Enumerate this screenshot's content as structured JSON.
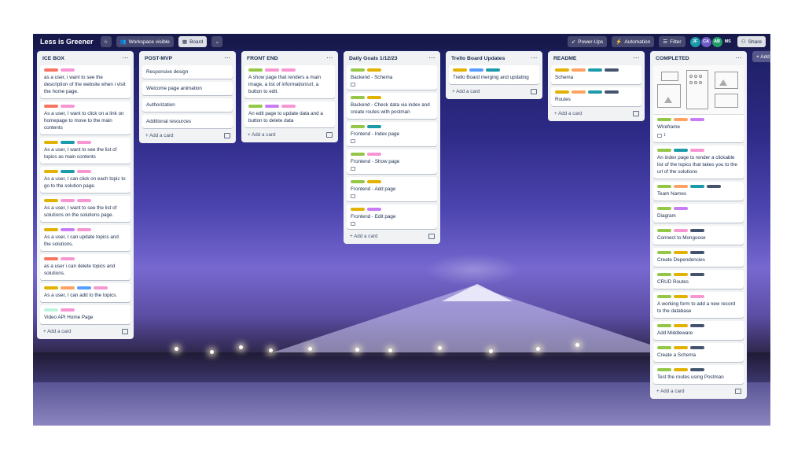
{
  "board": {
    "title": "Less is Greener",
    "visibility_label": "Workspace visible",
    "view_label": "Board",
    "powerups_label": "Power-Ups",
    "automation_label": "Automation",
    "filter_label": "Filter",
    "share_label": "Share",
    "avatars": [
      "JF",
      "CA",
      "AB",
      "MS"
    ],
    "add_list_label": "+ Add another list"
  },
  "labels_colors": {
    "red": "#f87462",
    "pink": "#f797d2",
    "green": "#4bce97",
    "yellow": "#e2b203",
    "teal": "#1d9aaa",
    "purple": "#c97cf4",
    "orange": "#fea362",
    "blue": "#579dff",
    "navy": "#44546f",
    "lightgreen": "#94c748",
    "mint": "#baf3db"
  },
  "add_card_label": "Add a card",
  "lists": [
    {
      "title": "ICE BOX",
      "cards": [
        {
          "labels": [
            "red",
            "pink"
          ],
          "text": "as a user, i want to see the description of the website when i visit the home page."
        },
        {
          "labels": [
            "red",
            "pink"
          ],
          "text": "As a user, I want to click on a link on homepage to move to the main contents"
        },
        {
          "labels": [
            "yellow",
            "teal",
            "pink"
          ],
          "text": "As a user, I want to see the list of topics as main contents"
        },
        {
          "labels": [
            "yellow",
            "teal",
            "pink"
          ],
          "text": "As a user, I can click on each topic to go to the solution page."
        },
        {
          "labels": [
            "yellow",
            "pink",
            "pink"
          ],
          "text": "As a user, I want to see the list of solutions on the solutions page."
        },
        {
          "labels": [
            "yellow",
            "purple",
            "pink"
          ],
          "text": "As a user, I can update topics and the solutions."
        },
        {
          "labels": [
            "red",
            "pink"
          ],
          "text": "as a user i can delete topics and solutions."
        },
        {
          "labels": [
            "yellow",
            "orange",
            "blue",
            "pink"
          ],
          "text": "As a user, I can add to the topics."
        },
        {
          "labels": [
            "mint",
            "pink"
          ],
          "text": "Video API Home Page"
        }
      ]
    },
    {
      "title": "POST-MVP",
      "cards": [
        {
          "labels": [],
          "text": "Responsive design"
        },
        {
          "labels": [],
          "text": "Welcome page animation"
        },
        {
          "labels": [],
          "text": "Authorization"
        },
        {
          "labels": [],
          "text": "Additional resources"
        }
      ]
    },
    {
      "title": "FRONT END",
      "cards": [
        {
          "labels": [
            "lightgreen",
            "pink",
            "pink"
          ],
          "text": "A show page that renders a main image, a list of information/url, a button to edit."
        },
        {
          "labels": [
            "lightgreen",
            "purple",
            "pink"
          ],
          "text": "An edit page to update data and a button to delete data"
        }
      ]
    },
    {
      "title": "Daily Goals 1/12/23",
      "cards": [
        {
          "labels": [
            "lightgreen",
            "yellow"
          ],
          "text": "Backend - Schema",
          "comment": true
        },
        {
          "labels": [
            "lightgreen",
            "yellow"
          ],
          "text": "Backend - Check data via index and create routes with postman"
        },
        {
          "labels": [
            "lightgreen",
            "teal"
          ],
          "text": "Frontend - Index page",
          "comment": true
        },
        {
          "labels": [
            "lightgreen",
            "pink"
          ],
          "text": "Frontend - Show page",
          "comment": true
        },
        {
          "labels": [
            "lightgreen",
            "yellow"
          ],
          "text": "Frontend - Add page",
          "comment": true
        },
        {
          "labels": [
            "yellow",
            "purple"
          ],
          "text": "Frontend - Edit page",
          "comment": true
        }
      ]
    },
    {
      "title": "Trello Board Updates",
      "cards": [
        {
          "labels": [
            "yellow",
            "blue",
            "teal"
          ],
          "text": "Trello Board merging and updating"
        }
      ]
    },
    {
      "title": "README",
      "cards": [
        {
          "labels": [
            "yellow",
            "orange",
            "teal",
            "navy"
          ],
          "text": "Schema"
        },
        {
          "labels": [
            "yellow",
            "orange",
            "teal",
            "navy"
          ],
          "text": "Routes"
        }
      ]
    },
    {
      "title": "COMPLETED",
      "cards": [
        {
          "labels": [
            "lightgreen",
            "orange",
            "purple"
          ],
          "text": "Wireframe",
          "wireframe": true,
          "attachments": "1"
        },
        {
          "labels": [
            "lightgreen",
            "teal",
            "pink"
          ],
          "text": "An index page to render a clickable list of the topics that takes you to the url of the solutions"
        },
        {
          "labels": [
            "lightgreen",
            "orange",
            "teal",
            "navy"
          ],
          "text": "Team Names"
        },
        {
          "labels": [
            "lightgreen",
            "purple"
          ],
          "text": "Diagram"
        },
        {
          "labels": [
            "lightgreen",
            "pink",
            "navy"
          ],
          "text": "Connect to Mongoose"
        },
        {
          "labels": [
            "lightgreen",
            "yellow",
            "navy"
          ],
          "text": "Create Dependencies"
        },
        {
          "labels": [
            "lightgreen",
            "yellow",
            "navy"
          ],
          "text": "CRUD Routes"
        },
        {
          "labels": [
            "lightgreen",
            "yellow",
            "pink"
          ],
          "text": "A working form to add a new record to the database"
        },
        {
          "labels": [
            "lightgreen",
            "yellow",
            "navy"
          ],
          "text": "Add Middleware"
        },
        {
          "labels": [
            "lightgreen",
            "yellow",
            "navy"
          ],
          "text": "Create a Schema"
        },
        {
          "labels": [
            "lightgreen",
            "yellow",
            "navy"
          ],
          "text": "Test the routes using Postman"
        }
      ]
    }
  ]
}
